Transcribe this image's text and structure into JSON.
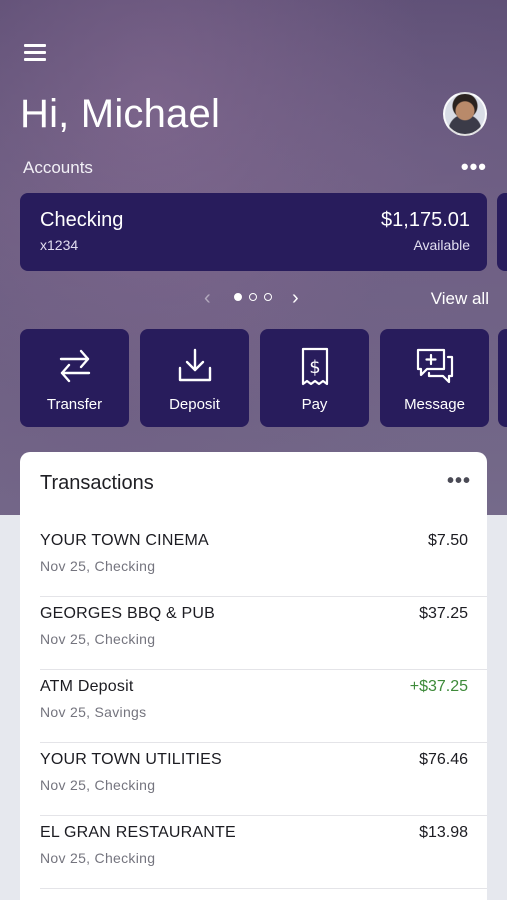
{
  "header": {
    "greeting": "Hi, Michael",
    "accounts_label": "Accounts",
    "more_label": "•••"
  },
  "account_card": {
    "name": "Checking",
    "number": "x1234",
    "balance": "$1,175.01",
    "balance_label": "Available"
  },
  "pager": {
    "prev": "‹",
    "next": "›",
    "active_index": 0,
    "count": 3,
    "view_all": "View all"
  },
  "actions": [
    {
      "label": "Transfer",
      "icon": "transfer-icon"
    },
    {
      "label": "Deposit",
      "icon": "deposit-icon"
    },
    {
      "label": "Pay",
      "icon": "pay-bill-icon"
    },
    {
      "label": "Message",
      "icon": "message-icon"
    }
  ],
  "transactions": {
    "title": "Transactions",
    "more_label": "•••",
    "items": [
      {
        "merchant": "YOUR TOWN CINEMA",
        "meta": "Nov 25, Checking",
        "amount": "$7.50"
      },
      {
        "merchant": "GEORGES BBQ & PUB",
        "meta": "Nov 25, Checking",
        "amount": "$37.25"
      },
      {
        "merchant": "ATM Deposit",
        "meta": "Nov 25, Savings",
        "amount": "+$37.25"
      },
      {
        "merchant": "YOUR TOWN UTILITIES",
        "meta": "Nov 25, Checking",
        "amount": "$76.46"
      },
      {
        "merchant": "EL GRAN RESTAURANTE",
        "meta": "Nov 25, Checking",
        "amount": "$13.98"
      }
    ]
  },
  "colors": {
    "card": "#281c5c",
    "credit": "#3e8a3a"
  }
}
